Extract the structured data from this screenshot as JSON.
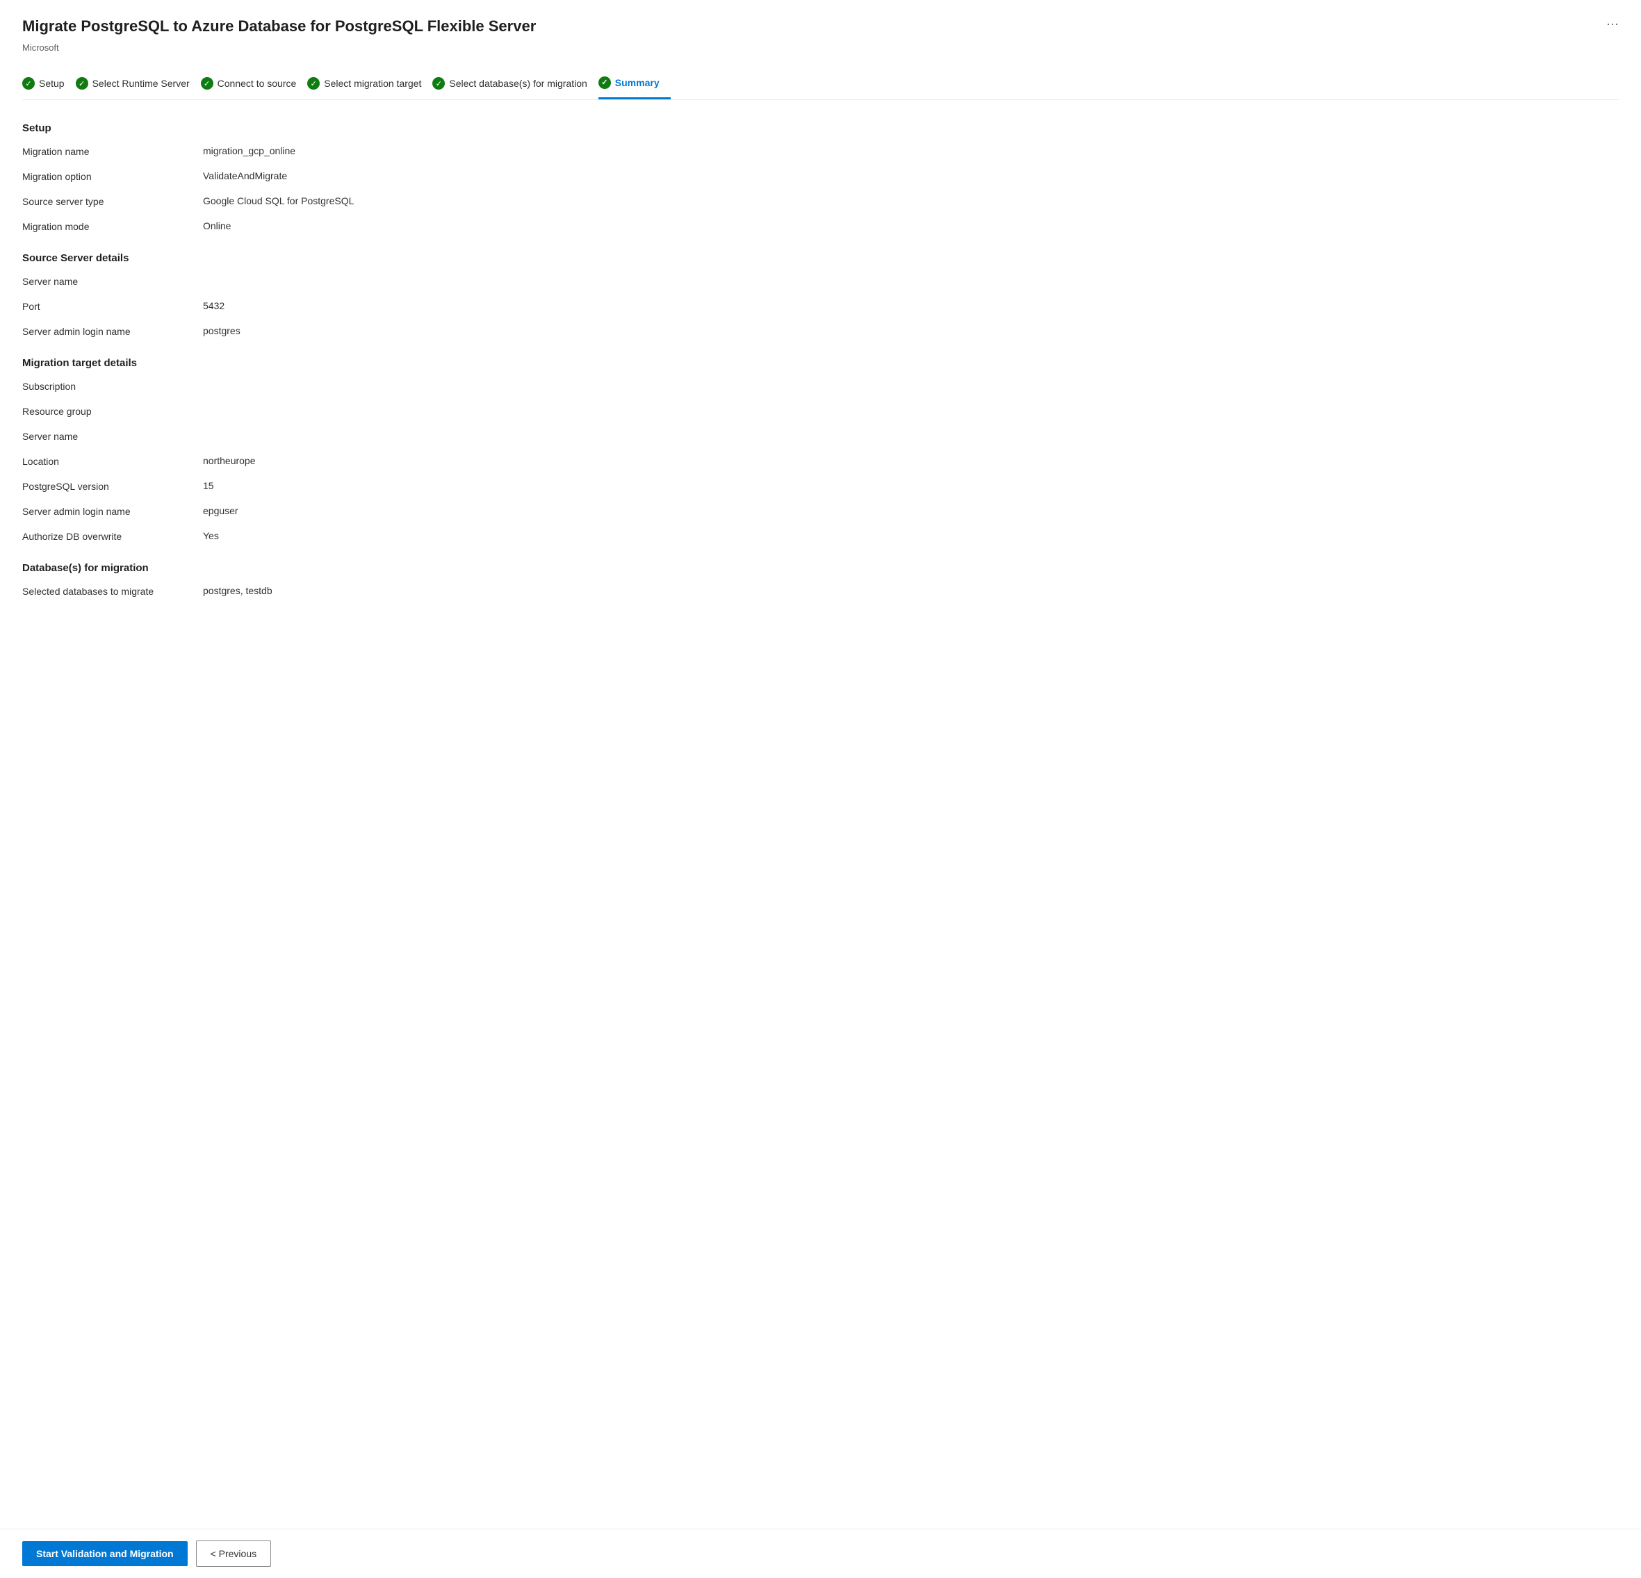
{
  "header": {
    "title": "Migrate PostgreSQL to Azure Database for PostgreSQL Flexible Server",
    "subtitle": "Microsoft",
    "ellipsis": "···"
  },
  "wizard": {
    "steps": [
      {
        "id": "setup",
        "label": "Setup",
        "completed": true,
        "active": false
      },
      {
        "id": "runtime",
        "label": "Select Runtime Server",
        "completed": true,
        "active": false
      },
      {
        "id": "source",
        "label": "Connect to source",
        "completed": true,
        "active": false
      },
      {
        "id": "target",
        "label": "Select migration target",
        "completed": true,
        "active": false
      },
      {
        "id": "databases",
        "label": "Select database(s) for migration",
        "completed": true,
        "active": false
      },
      {
        "id": "summary",
        "label": "Summary",
        "completed": true,
        "active": true
      }
    ]
  },
  "sections": {
    "setup": {
      "title": "Setup",
      "fields": [
        {
          "label": "Migration name",
          "value": "migration_gcp_online"
        },
        {
          "label": "Migration option",
          "value": "ValidateAndMigrate"
        },
        {
          "label": "Source server type",
          "value": "Google Cloud SQL for PostgreSQL"
        },
        {
          "label": "Migration mode",
          "value": "Online"
        }
      ]
    },
    "source": {
      "title": "Source Server details",
      "fields": [
        {
          "label": "Server name",
          "value": ""
        },
        {
          "label": "Port",
          "value": "5432"
        },
        {
          "label": "Server admin login name",
          "value": "postgres"
        }
      ]
    },
    "target": {
      "title": "Migration target details",
      "fields": [
        {
          "label": "Subscription",
          "value": ""
        },
        {
          "label": "Resource group",
          "value": ""
        },
        {
          "label": "Server name",
          "value": ""
        },
        {
          "label": "Location",
          "value": "northeurope"
        },
        {
          "label": "PostgreSQL version",
          "value": "15"
        },
        {
          "label": "Server admin login name",
          "value": "epguser"
        },
        {
          "label": "Authorize DB overwrite",
          "value": "Yes"
        }
      ]
    },
    "databases": {
      "title": "Database(s) for migration",
      "fields": [
        {
          "label": "Selected databases to migrate",
          "value": "postgres, testdb"
        }
      ]
    }
  },
  "footer": {
    "primary_button": "Start Validation and Migration",
    "secondary_button": "< Previous"
  }
}
